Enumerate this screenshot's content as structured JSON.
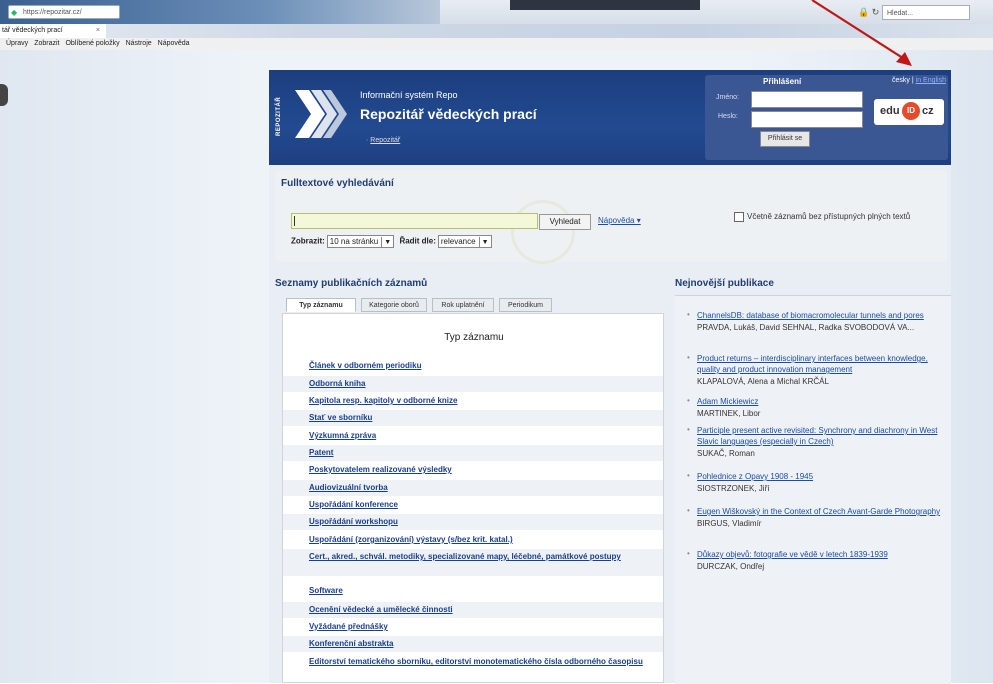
{
  "browser": {
    "url": "https://repozitar.cz/",
    "tab_title": "tář vědeckých prací",
    "tab_close": "×",
    "search_placeholder": "Hledat...",
    "menu": [
      "Úpravy",
      "Zobrazit",
      "Oblíbené položky",
      "Nástroje",
      "Nápověda"
    ]
  },
  "header": {
    "side_label": "REPOZITÁŘ",
    "info_title": "Informační systém Repo",
    "main_title": "Repozitář vědeckých prací",
    "breadcrumb_prefix": "· ",
    "breadcrumb": "Repozitář"
  },
  "login": {
    "title": "Přihlášení",
    "lang_cz": "česky",
    "lang_sep": " | ",
    "lang_en": "in English",
    "name_label": "Jméno:",
    "password_label": "Heslo:",
    "button": "Přihlásit se",
    "eduid_left": "edu",
    "eduid_mid": "ID",
    "eduid_right": "cz"
  },
  "search": {
    "heading": "Fulltextové vyhledávání",
    "button": "Vyhledat",
    "help": "Nápověda",
    "help_suffix": " ▾",
    "checkbox_label": "Včetně záznamů bez přístupných plných textů",
    "show_label": "Zobrazit:",
    "show_value": "10 na stránku",
    "sort_label": "Řadit dle:",
    "sort_value": "relevance"
  },
  "lists": {
    "heading": "Seznamy publikačních záznamů",
    "tabs": [
      "Typ záznamu",
      "Kategorie oborů",
      "Rok uplatnění",
      "Periodikum"
    ],
    "panel_title": "Typ záznamu",
    "items": [
      "Článek v odborném periodiku",
      "Odborná kniha",
      "Kapitola resp. kapitoly v odborné knize",
      "Stať ve sborníku",
      "Výzkumná zpráva",
      "Patent",
      "Poskytovatelem realizované výsledky",
      "Audiovizuální tvorba",
      "Uspořádání konference",
      "Uspořádání workshopu",
      "Uspořádání (zorganizování) výstavy (s/bez krit. katal.)",
      "Cert., akred., schvál. metodiky, specializované mapy, léčebné, památkové postupy",
      "Software",
      "Ocenění vědecké a umělecké činnosti",
      "Vyžádané přednášky",
      "Konferenční abstrakta",
      "Editorství tematického sborníku, editorství monotematického čísla odborného časopisu"
    ]
  },
  "newest": {
    "heading": "Nejnovější publikace",
    "items": [
      {
        "title": "ChannelsDB: database of biomacromolecular tunnels and pores",
        "authors": "PRAVDA, Lukáš, David SEHNAL, Radka SVOBODOVÁ VA..."
      },
      {
        "title": "Product returns – interdisciplinary interfaces between knowledge, quality and product innovation management",
        "authors": "KLAPALOVÁ, Alena a Michal KRČÁL"
      },
      {
        "title": "Adam Mickiewicz",
        "authors": "MARTINEK, Libor"
      },
      {
        "title": "Participle present active revisited: Synchrony and diachrony in West Slavic languages (especially in Czech)",
        "authors": "SUKAČ, Roman"
      },
      {
        "title": "Pohlednice z Opavy 1908 - 1945",
        "authors": "SIOSTRZONEK, Jiří"
      },
      {
        "title": "Eugen Wiškovský in the Context of Czech Avant-Garde Photography",
        "authors": "BIRGUS, Vladimír"
      },
      {
        "title": "Důkazy objevů: fotografie ve vědě v letech 1839-1939",
        "authors": "DURCZAK, Ondřej"
      }
    ]
  },
  "colors": {
    "header_bg": "#1c3e7e",
    "link": "#1a4ca8",
    "annotation_arrow": "#c01818"
  }
}
